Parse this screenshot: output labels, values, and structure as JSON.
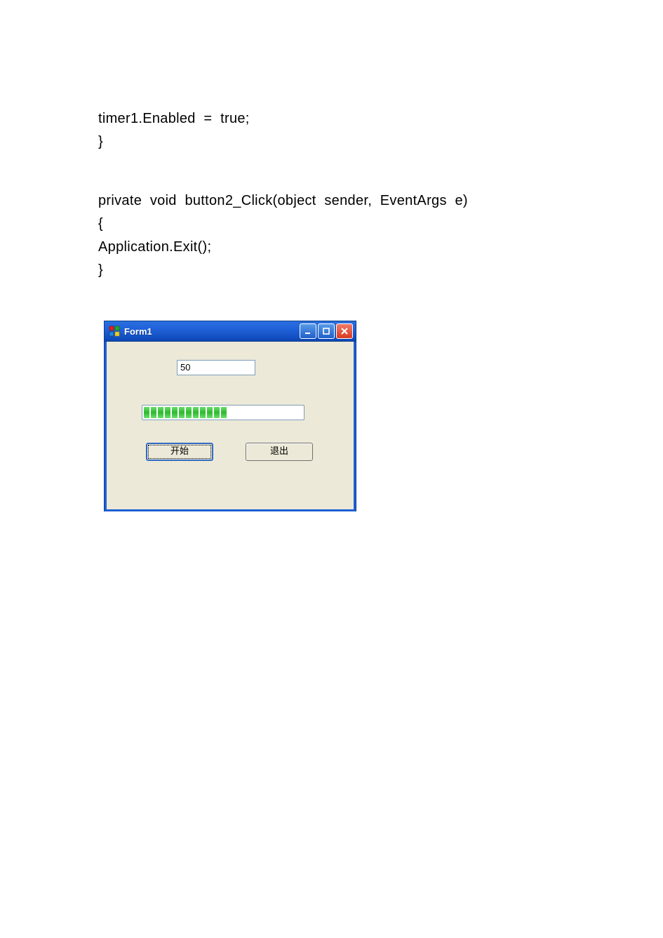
{
  "code": {
    "line1": "timer1.Enabled  =  true;",
    "line2": "}",
    "line3": "private  void  button2_Click(object  sender,  EventArgs  e)",
    "line4": "{",
    "line5": "Application.Exit();",
    "line6": "}"
  },
  "form": {
    "title": "Form1",
    "textbox_value": "50",
    "progress_blocks": 12,
    "button_start": "开始",
    "button_exit": "退出"
  }
}
